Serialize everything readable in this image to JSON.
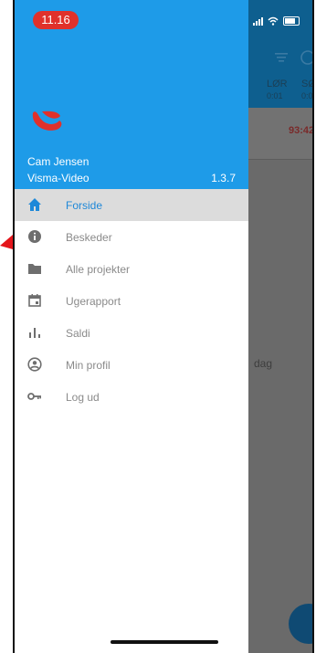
{
  "status": {
    "time": "11.16"
  },
  "background": {
    "day_labels": [
      "LØR",
      "SØ"
    ],
    "day_sub": [
      "0:01",
      "0:0"
    ],
    "hours_value": "93:42",
    "side_text": "dag"
  },
  "drawer": {
    "user_name": "Cam Jensen",
    "app_name": "Visma-Video",
    "version": "1.3.7",
    "menu": [
      {
        "label": "Forside",
        "icon": "home-icon",
        "active": true
      },
      {
        "label": "Beskeder",
        "icon": "info-icon"
      },
      {
        "label": "Alle projekter",
        "icon": "folder-icon"
      },
      {
        "label": "Ugerapport",
        "icon": "calendar-icon"
      },
      {
        "label": "Saldi",
        "icon": "bar-chart-icon"
      },
      {
        "label": "Min profil",
        "icon": "account-icon"
      },
      {
        "label": "Log ud",
        "icon": "key-icon"
      }
    ]
  },
  "colors": {
    "header_blue": "#1e9be8",
    "active_blue": "#1e88d8",
    "time_red": "#e0312b",
    "logo_red": "#e0312b"
  }
}
